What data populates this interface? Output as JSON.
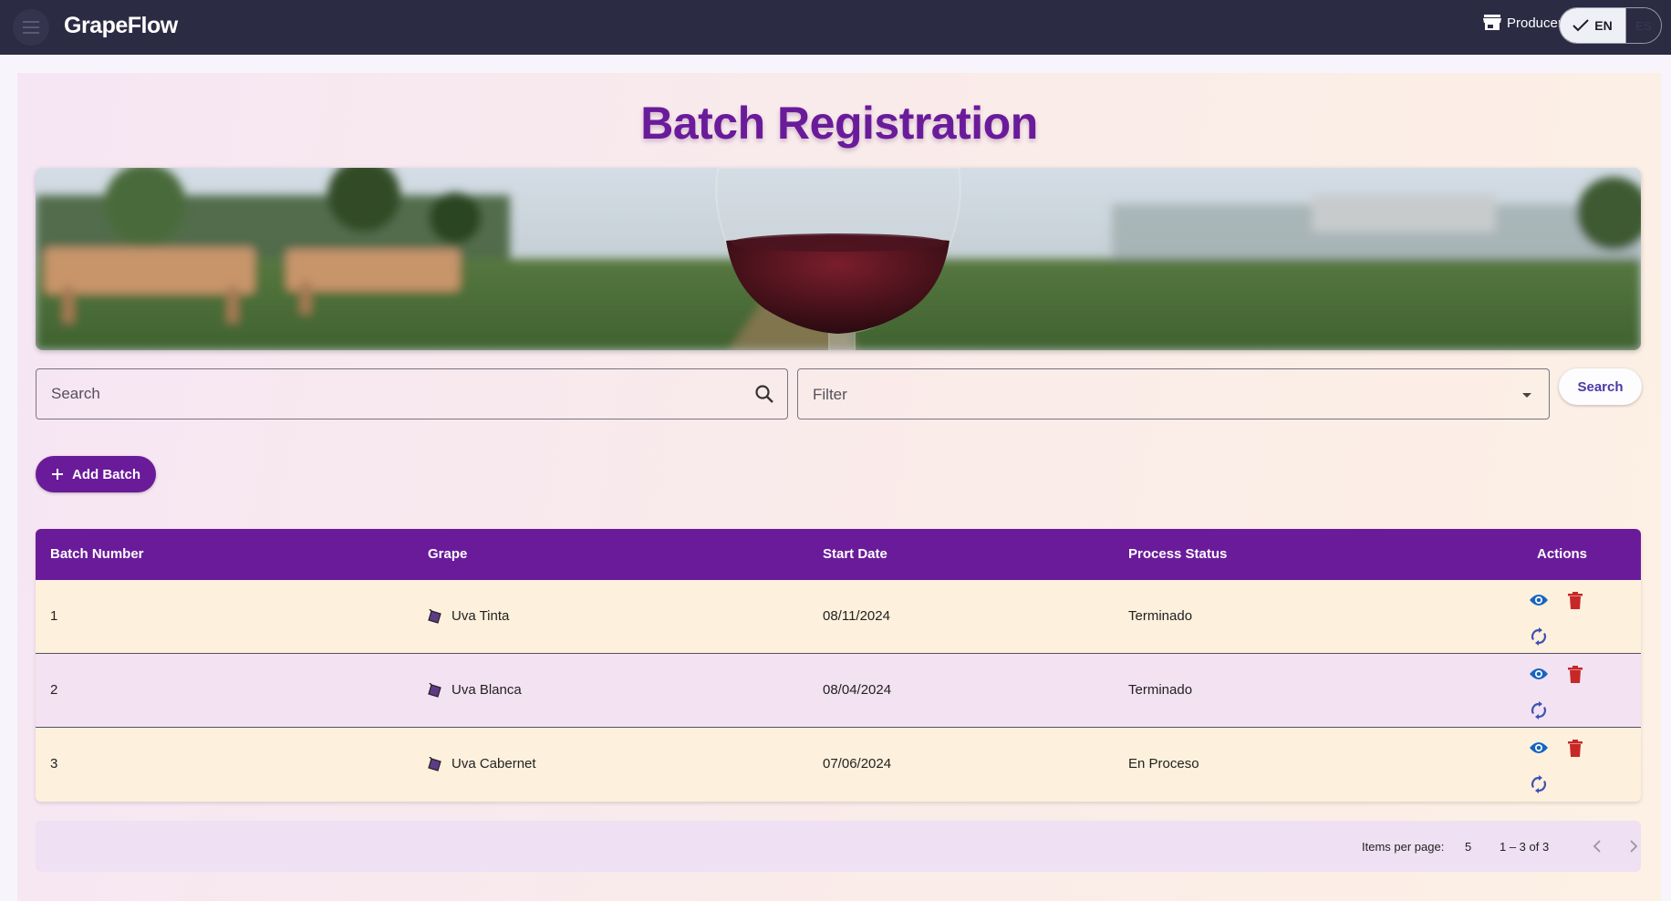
{
  "app": {
    "brand": "GrapeFlow"
  },
  "header": {
    "role_label": "Producer",
    "languages": {
      "en": "EN",
      "es": "ES",
      "selected": "EN"
    }
  },
  "page": {
    "title": "Batch Registration"
  },
  "search": {
    "placeholder": "Search",
    "filter_label": "Filter",
    "button_label": "Search"
  },
  "actions": {
    "add_label": "Add Batch"
  },
  "table": {
    "columns": [
      "Batch Number",
      "Grape",
      "Start Date",
      "Process Status",
      "Actions"
    ],
    "rows": [
      {
        "batch": "1",
        "grape": "Uva Tinta",
        "start_date": "08/11/2024",
        "status": "Terminado"
      },
      {
        "batch": "2",
        "grape": "Uva Blanca",
        "start_date": "08/04/2024",
        "status": "Terminado"
      },
      {
        "batch": "3",
        "grape": "Uva Cabernet",
        "start_date": "07/06/2024",
        "status": "En Proceso"
      }
    ]
  },
  "paginator": {
    "items_per_page_label": "Items per page:",
    "page_size": "5",
    "range": "1 – 3 of 3"
  },
  "colors": {
    "primary": "#6a1b9a",
    "topbar": "#2c2b44",
    "view_icon": "#1565c0",
    "delete_icon": "#c62828",
    "sync_icon": "#3f51b5"
  },
  "icons": [
    "menu-icon",
    "store-icon",
    "check-icon",
    "search-icon",
    "dropdown-arrow-icon",
    "plus-icon",
    "grape-icon",
    "eye-icon",
    "trash-icon",
    "sync-icon",
    "chevron-left-icon",
    "chevron-right-icon"
  ]
}
